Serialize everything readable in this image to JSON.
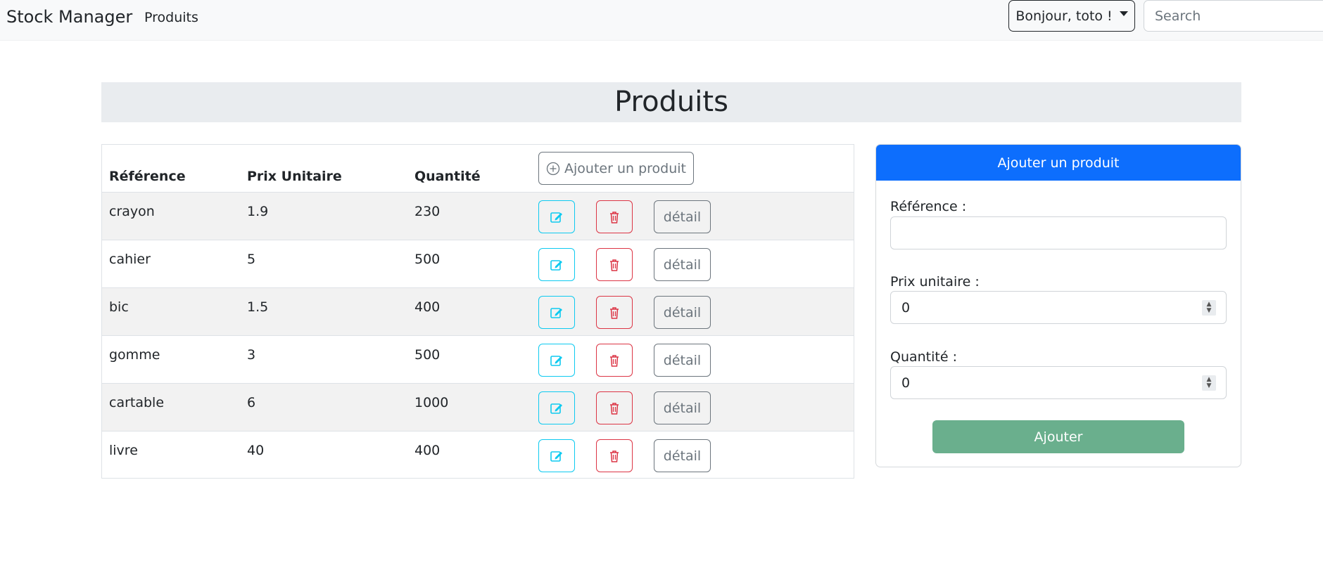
{
  "navbar": {
    "brand": "Stock Manager",
    "link": "Produits",
    "user_menu": "Bonjour, toto !",
    "search_placeholder": "Search"
  },
  "page": {
    "title": "Produits"
  },
  "table": {
    "headers": {
      "reference": "Référence",
      "price": "Prix Unitaire",
      "quantity": "Quantité"
    },
    "add_button": "Ajouter un produit",
    "detail_label": "détail",
    "rows": [
      {
        "reference": "crayon",
        "price": "1.9",
        "quantity": "230"
      },
      {
        "reference": "cahier",
        "price": "5",
        "quantity": "500"
      },
      {
        "reference": "bic",
        "price": "1.5",
        "quantity": "400"
      },
      {
        "reference": "gomme",
        "price": "3",
        "quantity": "500"
      },
      {
        "reference": "cartable",
        "price": "6",
        "quantity": "1000"
      },
      {
        "reference": "livre",
        "price": "40",
        "quantity": "400"
      }
    ]
  },
  "form": {
    "header": "Ajouter un produit",
    "reference_label": "Référence :",
    "reference_value": "",
    "price_label": "Prix unitaire :",
    "price_value": "0",
    "quantity_label": "Quantité :",
    "quantity_value": "0",
    "submit": "Ajouter"
  },
  "colors": {
    "primary": "#0d6efd",
    "info": "#0dcaf0",
    "danger": "#dc3545",
    "success_disabled": "#6aaf8d",
    "secondary": "#6c757d"
  },
  "icons": [
    "caret-down-icon",
    "plus-circle-icon",
    "edit-icon",
    "trash-icon",
    "spinner-icon"
  ]
}
